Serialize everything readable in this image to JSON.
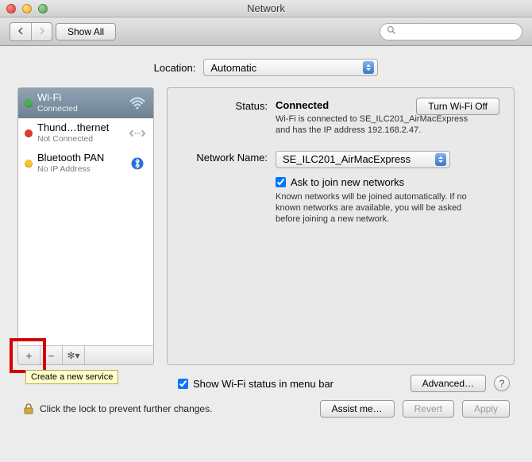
{
  "window": {
    "title": "Network"
  },
  "toolbar": {
    "show_all": "Show All",
    "search_placeholder": ""
  },
  "location": {
    "label": "Location:",
    "value": "Automatic"
  },
  "services": [
    {
      "name": "Wi-Fi",
      "state": "Connected",
      "dot": "green",
      "icon": "wifi",
      "selected": true
    },
    {
      "name": "Thund…thernet",
      "state": "Not Connected",
      "dot": "red",
      "icon": "ethernet",
      "selected": false
    },
    {
      "name": "Bluetooth PAN",
      "state": "No IP Address",
      "dot": "yellow",
      "icon": "bluetooth",
      "selected": false
    }
  ],
  "sidebar_buttons": {
    "add_tooltip": "Create a new service"
  },
  "detail": {
    "status_label": "Status:",
    "status_value": "Connected",
    "wifi_off": "Turn Wi-Fi Off",
    "status_desc": "Wi-Fi is connected to SE_ILC201_AirMacExpress and has the IP address 192.168.2.47.",
    "netname_label": "Network Name:",
    "netname_value": "SE_ILC201_AirMacExpress",
    "ask_label": "Ask to join new networks",
    "ask_desc": "Known networks will be joined automatically. If no known networks are available, you will be asked before joining a new network."
  },
  "footer": {
    "menubar_label": "Show Wi-Fi status in menu bar",
    "advanced": "Advanced…",
    "lock_text": "Click the lock to prevent further changes.",
    "assist": "Assist me…",
    "revert": "Revert",
    "apply": "Apply"
  }
}
